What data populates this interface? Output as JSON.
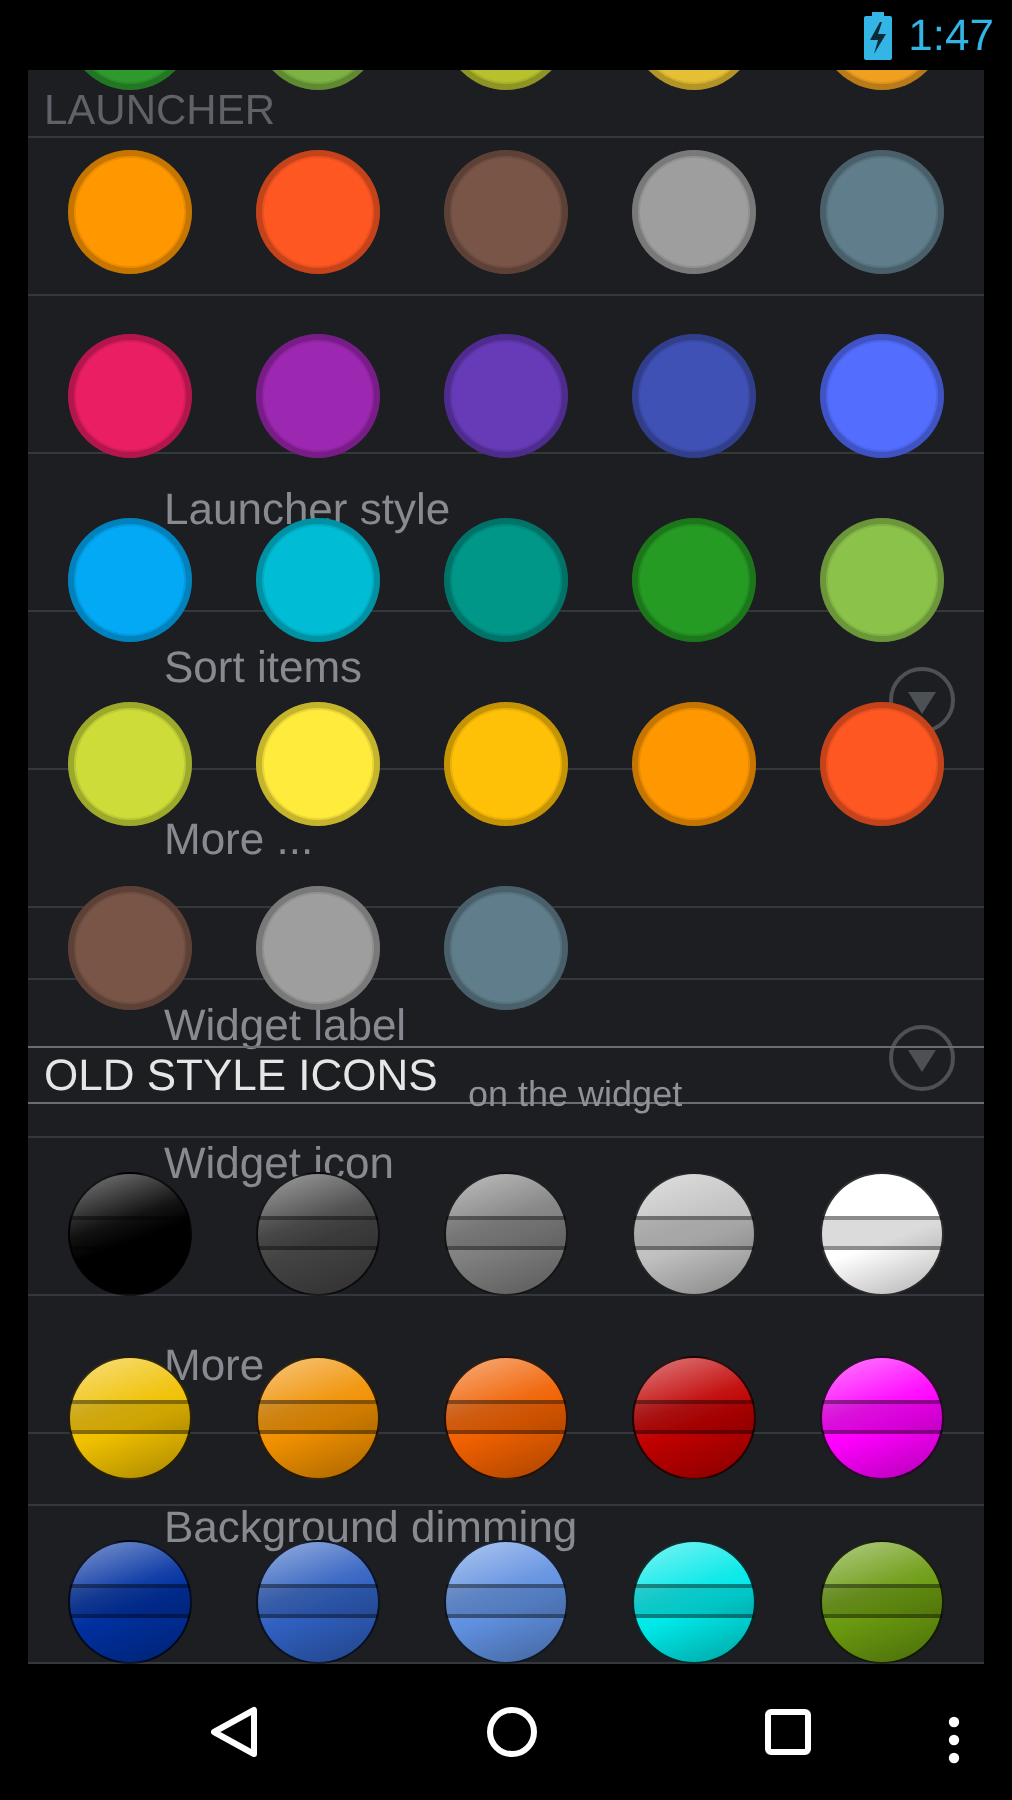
{
  "status_bar": {
    "time": "1:47"
  },
  "settings": [
    {
      "kind": "header",
      "title": "LAUNCHER"
    },
    {
      "kind": "row"
    },
    {
      "kind": "row"
    },
    {
      "kind": "row",
      "title": "Launcher style"
    },
    {
      "kind": "row",
      "title": "Sort items",
      "dropdown": true
    },
    {
      "kind": "more",
      "title": "More ..."
    },
    {
      "kind": "header"
    },
    {
      "kind": "row",
      "title": "Widget label",
      "subtitle": "on the widget",
      "dropdown": true
    },
    {
      "kind": "row",
      "title": "Widget icon"
    },
    {
      "kind": "more",
      "title": "More"
    },
    {
      "kind": "header"
    },
    {
      "kind": "row",
      "title": "Background dimming"
    }
  ],
  "picker": {
    "sections": [
      {
        "kind": "material",
        "swatches": [
          {
            "color": "#2e9a2e"
          },
          {
            "color": "#7cb342"
          },
          {
            "color": "#b7c12e"
          },
          {
            "color": "#e6c034"
          },
          {
            "color": "#f0a020"
          },
          {
            "color": "#ff9800"
          },
          {
            "color": "#ff5722"
          },
          {
            "color": "#795548"
          },
          {
            "color": "#9e9e9e"
          },
          {
            "color": "#607d8b"
          },
          {
            "color": "#e91e63"
          },
          {
            "color": "#9c27b0"
          },
          {
            "color": "#673ab7"
          },
          {
            "color": "#3f51b5"
          },
          {
            "color": "#536dfe"
          },
          {
            "color": "#03a9f4"
          },
          {
            "color": "#00bcd4"
          },
          {
            "color": "#009688"
          },
          {
            "color": "#259b24"
          },
          {
            "color": "#8bc34a"
          },
          {
            "color": "#cddc39"
          },
          {
            "color": "#ffeb3b"
          },
          {
            "color": "#ffc107"
          },
          {
            "color": "#ff9800"
          },
          {
            "color": "#ff5722"
          },
          {
            "color": "#795548"
          },
          {
            "color": "#9e9e9e"
          },
          {
            "color": "#607d8b"
          }
        ]
      },
      {
        "kind": "glossy",
        "title": "OLD STYLE ICONS",
        "swatches": [
          {
            "color": "#000000"
          },
          {
            "color": "#444444"
          },
          {
            "color": "#808080"
          },
          {
            "color": "#c0c0c0"
          },
          {
            "color": "#ffffff"
          },
          {
            "color": "#f0c000"
          },
          {
            "color": "#f09000"
          },
          {
            "color": "#f06000"
          },
          {
            "color": "#c00000"
          },
          {
            "color": "#ff00ff"
          },
          {
            "color": "#0030a0"
          },
          {
            "color": "#3060c0"
          },
          {
            "color": "#6090e0"
          },
          {
            "color": "#00e8e8"
          },
          {
            "color": "#6a9a10"
          }
        ]
      }
    ]
  }
}
